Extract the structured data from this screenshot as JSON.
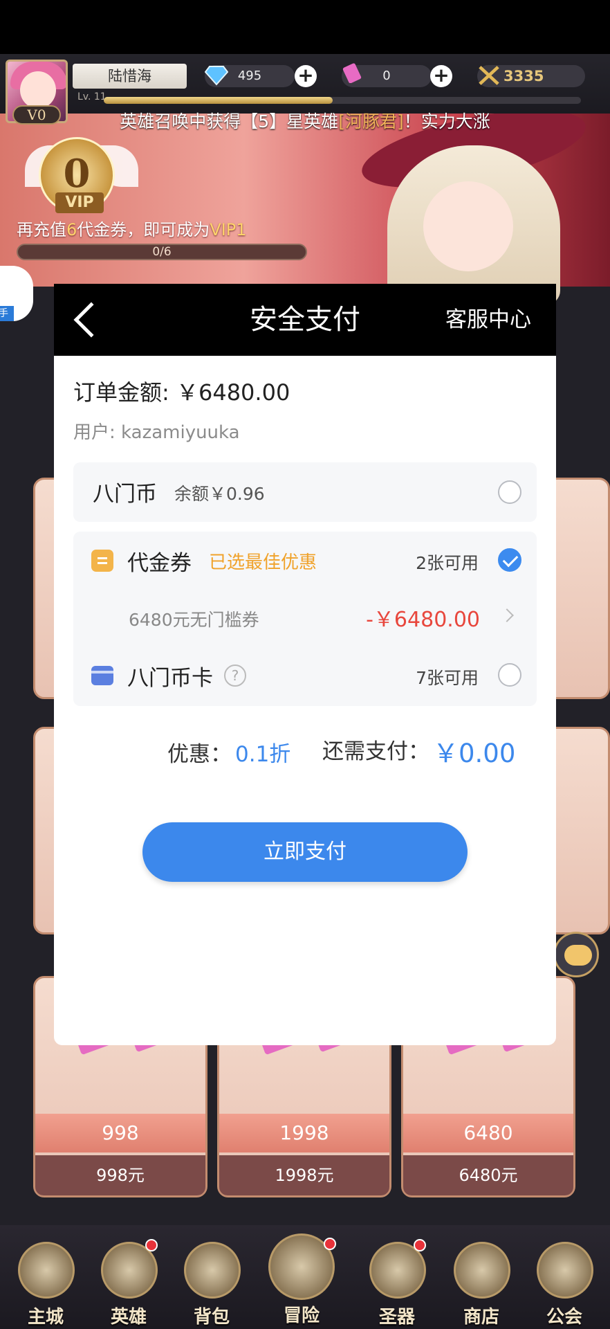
{
  "player": {
    "name": "陆惜海",
    "level": "Lv. 11",
    "vip_tag": "V0",
    "diamonds": "495",
    "tickets": "0",
    "power": "3335"
  },
  "ticker": {
    "prefix": "英雄召唤中获得【5】星英雄",
    "hero": "[河豚君]",
    "suffix": "！实力大涨"
  },
  "vip": {
    "level": "0",
    "word": "VIP",
    "recharge_prefix": "再充值",
    "recharge_amount": "6",
    "recharge_mid": "代金券，即可成为",
    "recharge_target": "VIP1",
    "progress_text": "0/6",
    "progress": 0.0
  },
  "side_badge": "手",
  "shop_cards": [
    {
      "tickets": "998",
      "price": "998元"
    },
    {
      "tickets": "1998",
      "price": "1998元"
    },
    {
      "tickets": "6480",
      "price": "6480元"
    }
  ],
  "nav": [
    {
      "label": "主城",
      "dot": false
    },
    {
      "label": "英雄",
      "dot": true
    },
    {
      "label": "背包",
      "dot": false
    },
    {
      "label": "冒险",
      "dot": true
    },
    {
      "label": "圣器",
      "dot": true
    },
    {
      "label": "商店",
      "dot": false
    },
    {
      "label": "公会",
      "dot": false
    }
  ],
  "payment": {
    "title": "安全支付",
    "service": "客服中心",
    "order_label": "订单金额:",
    "order_amount": "￥6480.00",
    "user_label": "用户:",
    "user_name": "kazamiyuuka",
    "bamen_coin": {
      "label": "八门币",
      "balance": "余额￥0.96",
      "selected": false
    },
    "voucher": {
      "label": "代金券",
      "hint": "已选最佳优惠",
      "available": "2张可用",
      "selected": true
    },
    "voucher_item": {
      "name": "6480元无门槛券",
      "amount": "-￥6480.00"
    },
    "bamen_card": {
      "label": "八门币卡",
      "available": "7张可用",
      "selected": false
    },
    "discount_label": "优惠：",
    "discount_value": "0.1折",
    "remain_label": "还需支付：",
    "remain_value": "￥0.00",
    "pay_button": "立即支付"
  },
  "colors": {
    "accent_blue": "#3c88ec",
    "voucher_orange": "#f0a22a",
    "deduct_red": "#e8473d"
  }
}
